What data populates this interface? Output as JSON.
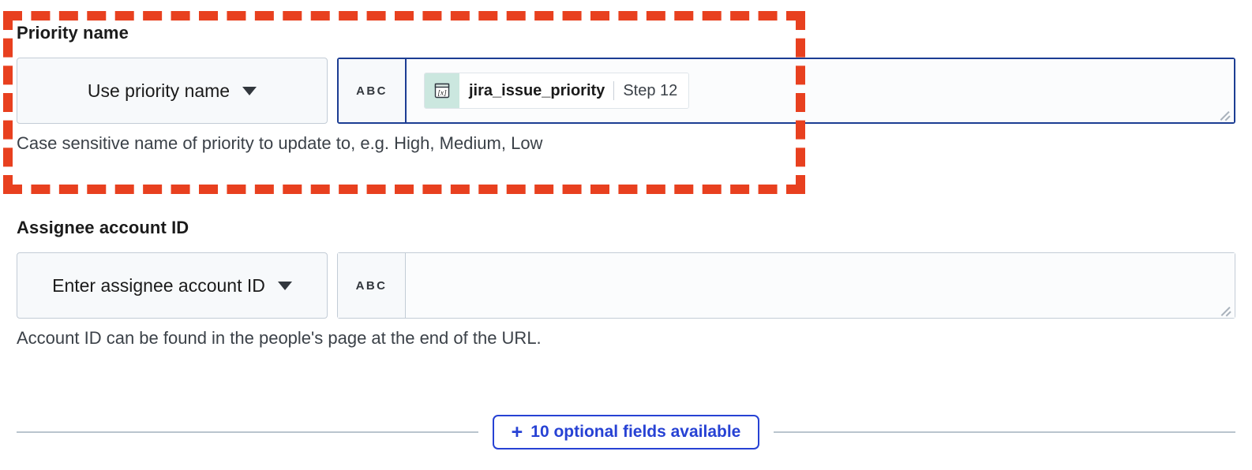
{
  "fields": [
    {
      "id": "priority-name",
      "label": "Priority name",
      "select_value": "Use priority name",
      "type_badge": "ABC",
      "focused": true,
      "chip": {
        "icon": "variable-expression-icon",
        "name": "jira_issue_priority",
        "step": "Step 12"
      },
      "help": "Case sensitive name of priority to update to, e.g. High, Medium, Low"
    },
    {
      "id": "assignee-account-id",
      "label": "Assignee account ID",
      "select_value": "Enter assignee account ID",
      "type_badge": "ABC",
      "focused": false,
      "chip": null,
      "help": "Account ID can be found in the people's page at the end of the URL."
    }
  ],
  "footer": {
    "plus": "+",
    "optional_fields_label": "10 optional fields available"
  },
  "icons": {
    "caret": "chevron-down-icon",
    "resize": "resize-grip-icon",
    "annotation": "red-dashed-highlight"
  },
  "colors": {
    "annotation_red": "#E8401F",
    "focus_blue": "#1C3D93",
    "accent_blue": "#2742D4",
    "chip_icon_bg": "#CBE7DF",
    "border_gray": "#C3CCD6",
    "field_bg": "#F7F9FB"
  }
}
